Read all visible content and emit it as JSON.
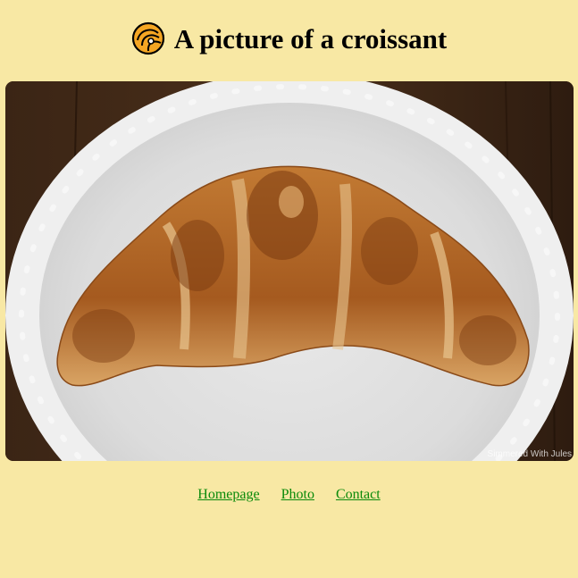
{
  "header": {
    "icon": "croissant-icon",
    "title": "A picture of a croissant"
  },
  "photo": {
    "alt": "croissant",
    "watermark": "Simmered With Jules"
  },
  "nav": {
    "links": [
      {
        "label": "Homepage"
      },
      {
        "label": "Photo"
      },
      {
        "label": "Contact"
      }
    ]
  },
  "colors": {
    "background": "#f8e8a4",
    "link": "#0a8a0a"
  }
}
